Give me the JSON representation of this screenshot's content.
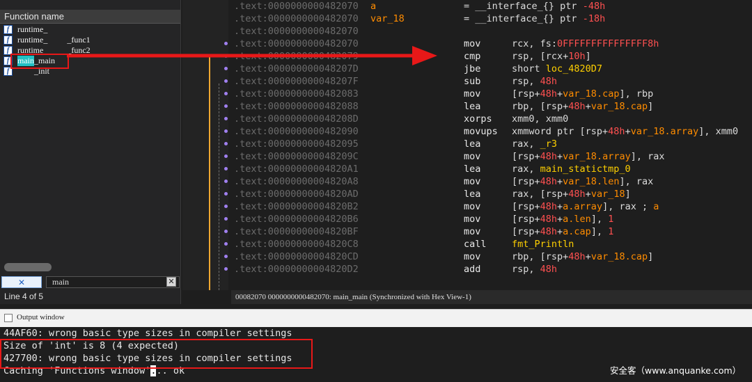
{
  "functions_window": {
    "column_header": "Function name",
    "items": [
      {
        "prefix": "runtime_",
        "highlight": "",
        "suffix": ""
      },
      {
        "prefix": "runtime_",
        "highlight": "",
        "suffix": "_func1"
      },
      {
        "prefix": "runtime_",
        "highlight": "",
        "suffix": "_func2"
      },
      {
        "prefix": "",
        "highlight": "main",
        "suffix": "_main"
      },
      {
        "prefix": "",
        "highlight": "",
        "suffix": "_init"
      }
    ],
    "search_value": "main",
    "status": "Line 4 of 5"
  },
  "disassembly": {
    "lines": [
      {
        "addr": ".text:0000000000482070",
        "label": "a",
        "text": "= __interface_{} ptr ",
        "num": "-48h"
      },
      {
        "addr": ".text:0000000000482070",
        "label": "var_18",
        "text": "= __interface_{} ptr ",
        "num": "-18h"
      },
      {
        "addr": ".text:0000000000482070"
      },
      {
        "addr": ".text:0000000000482070",
        "mnem": "mov",
        "ops": "rcx, fs:",
        "num": "0FFFFFFFFFFFFFFF8h"
      },
      {
        "addr": ".text:0000000000482079",
        "mnem": "cmp",
        "ops": "rsp, [rcx+",
        "num": "10h",
        "tail": "]"
      },
      {
        "addr": ".text:000000000048207D",
        "mnem": "jbe",
        "ops": "short ",
        "ref": "loc_4820D7"
      },
      {
        "addr": ".text:000000000048207F",
        "mnem": "sub",
        "ops": "rsp, ",
        "num": "48h"
      },
      {
        "addr": ".text:0000000000482083",
        "mnem": "mov",
        "ops": "[rsp+",
        "num": "48h",
        "mid": "+",
        "var": "var_18.cap",
        "tail": "], rbp"
      },
      {
        "addr": ".text:0000000000482088",
        "mnem": "lea",
        "ops": "rbp, [rsp+",
        "num": "48h",
        "mid": "+",
        "var": "var_18.cap",
        "tail": "]"
      },
      {
        "addr": ".text:000000000048208D",
        "mnem": "xorps",
        "ops": "xmm0, xmm0"
      },
      {
        "addr": ".text:0000000000482090",
        "mnem": "movups",
        "ops": "xmmword ptr [rsp+",
        "num": "48h",
        "mid": "+",
        "var": "var_18.array",
        "tail": "], xmm0"
      },
      {
        "addr": ".text:0000000000482095",
        "mnem": "lea",
        "ops": "rax, ",
        "ref": "_r3"
      },
      {
        "addr": ".text:000000000048209C",
        "mnem": "mov",
        "ops": "[rsp+",
        "num": "48h",
        "mid": "+",
        "var": "var_18.array",
        "tail": "], rax"
      },
      {
        "addr": ".text:00000000004820A1",
        "mnem": "lea",
        "ops": "rax, ",
        "ref": "main_statictmp_0"
      },
      {
        "addr": ".text:00000000004820A8",
        "mnem": "mov",
        "ops": "[rsp+",
        "num": "48h",
        "mid": "+",
        "var": "var_18.len",
        "tail": "], rax"
      },
      {
        "addr": ".text:00000000004820AD",
        "mnem": "lea",
        "ops": "rax, [rsp+",
        "num": "48h",
        "mid": "+",
        "var": "var_18",
        "tail": "]"
      },
      {
        "addr": ".text:00000000004820B2",
        "mnem": "mov",
        "ops": "[rsp+",
        "num": "48h",
        "mid": "+",
        "var": "a.array",
        "tail": "], rax ; ",
        "tail2": "a"
      },
      {
        "addr": ".text:00000000004820B6",
        "mnem": "mov",
        "ops": "[rsp+",
        "num": "48h",
        "mid": "+",
        "var": "a.len",
        "tail": "], ",
        "num2": "1"
      },
      {
        "addr": ".text:00000000004820BF",
        "mnem": "mov",
        "ops": "[rsp+",
        "num": "48h",
        "mid": "+",
        "var": "a.cap",
        "tail": "], ",
        "num2": "1"
      },
      {
        "addr": ".text:00000000004820C8",
        "mnem": "call",
        "ops": "",
        "ref": "fmt_Println"
      },
      {
        "addr": ".text:00000000004820CD",
        "mnem": "mov",
        "ops": "rbp, [rsp+",
        "num": "48h",
        "mid": "+",
        "var": "var_18.cap",
        "tail": "]"
      },
      {
        "addr": ".text:00000000004820D2",
        "mnem": "add",
        "ops": "rsp, ",
        "num": "48h"
      }
    ],
    "status": {
      "offset": "00082070",
      "location": "0000000000482070: main_main",
      "sync": "(Synchronized with Hex View-1)"
    }
  },
  "output_window": {
    "title": "Output window",
    "lines": [
      "44AF60: wrong basic type sizes in compiler settings",
      "Size of 'int' is 8 (4 expected)",
      "427700: wrong basic type sizes in compiler settings"
    ],
    "last_line_before": "Caching 'Functions window'",
    "last_line_cursor": ".",
    "last_line_after": ".. ok"
  },
  "watermark": "安全客（www.anquanke.com）",
  "colors": {
    "annotation_red": "#e81818",
    "label_orange": "#ff8c00",
    "number_red": "#ff5050",
    "reference_yellow": "#ffd000",
    "search_highlight_yellow": "#ffff3b",
    "selection_cyan": "#22c0c4"
  }
}
